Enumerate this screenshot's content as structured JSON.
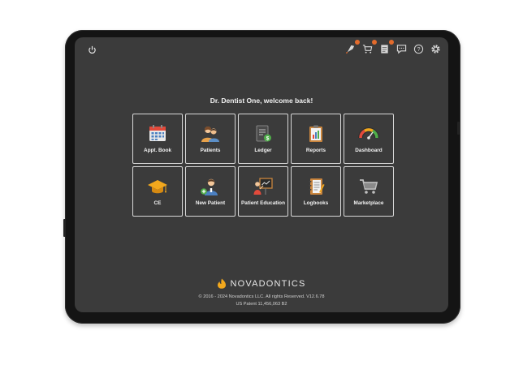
{
  "header": {
    "icons": [
      {
        "name": "rocket-icon",
        "badge": true
      },
      {
        "name": "cart-icon",
        "badge": true
      },
      {
        "name": "document-icon",
        "badge": true
      },
      {
        "name": "chat-icon",
        "badge": false
      },
      {
        "name": "help-icon",
        "badge": false
      },
      {
        "name": "gear-icon",
        "badge": false
      }
    ]
  },
  "welcome": "Dr. Dentist One, welcome back!",
  "tiles": [
    {
      "label": "Appt. Book",
      "icon": "calendar-icon"
    },
    {
      "label": "Patients",
      "icon": "patients-icon"
    },
    {
      "label": "Ledger",
      "icon": "ledger-icon"
    },
    {
      "label": "Reports",
      "icon": "reports-icon"
    },
    {
      "label": "Dashboard",
      "icon": "gauge-icon"
    },
    {
      "label": "CE",
      "icon": "graduation-cap-icon"
    },
    {
      "label": "New Patient",
      "icon": "new-patient-icon"
    },
    {
      "label": "Patient Education",
      "icon": "presentation-icon"
    },
    {
      "label": "Logbooks",
      "icon": "logbook-icon"
    },
    {
      "label": "Marketplace",
      "icon": "shopping-cart-icon"
    }
  ],
  "footer": {
    "brand": "NOVADONTICS",
    "copyright": "© 2016 - 2024 Novadontics LLC. All rights Reserved. V12.6.78",
    "patent": "US Patent 11,456,063 B2"
  },
  "colors": {
    "screen": "#3b3b3b",
    "tile_border": "#d9d9d9",
    "accent_orange": "#e36b2c",
    "brand_yellow": "#f2a81d"
  }
}
